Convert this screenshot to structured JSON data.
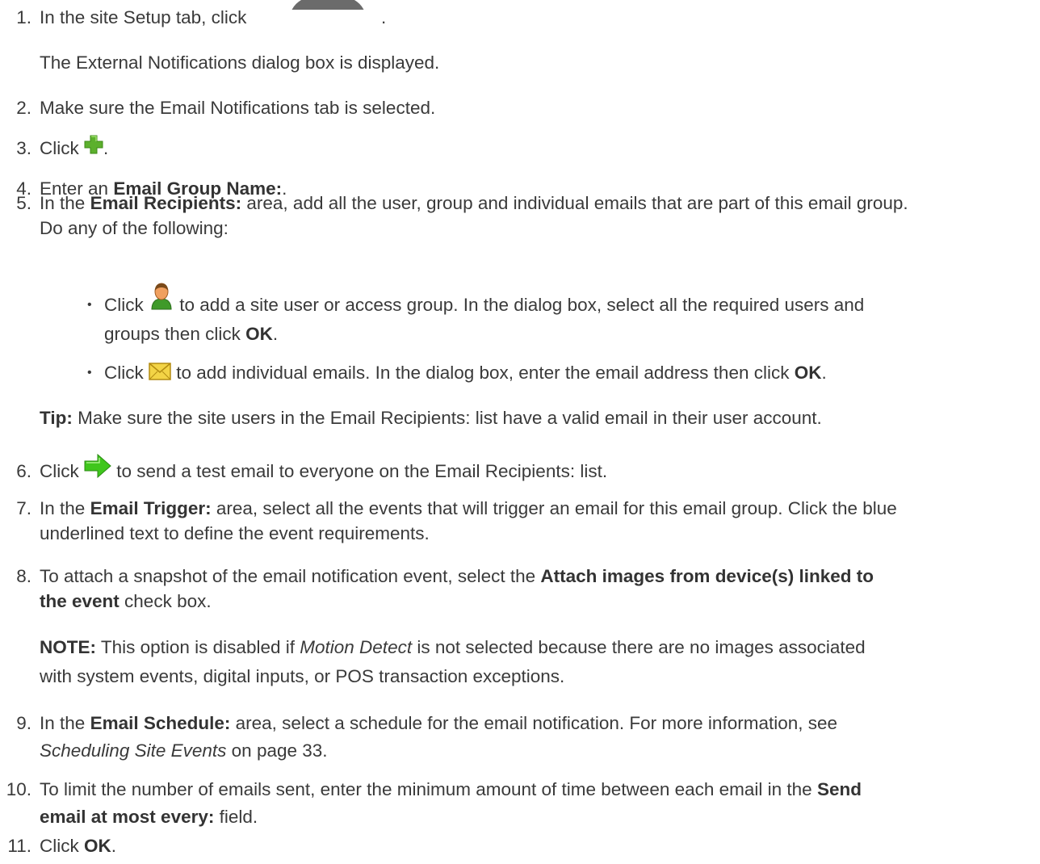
{
  "steps": {
    "s1": {
      "num": "1.",
      "pre": "In the site Setup tab, click",
      "post": "."
    },
    "s1_result": "The External Notifications dialog box is displayed.",
    "s2": {
      "num": "2.",
      "text": "Make sure the Email Notifications tab is selected."
    },
    "s3": {
      "num": "3.",
      "pre": "Click",
      "post": "."
    },
    "s4": {
      "num": "4.",
      "pre": "Enter an",
      "bold": "Email Group Name:",
      "post": "."
    },
    "s5": {
      "num": "5.",
      "pre": "In the",
      "bold": "Email Recipients:",
      "post": "area, add all the user, group and individual emails that are part of this email group.",
      "line2": "Do any of the following:"
    },
    "b1": {
      "pre": "Click",
      "post": "to add a site user or access group. In the dialog box, select all the required users and",
      "line2_pre": "groups then click",
      "line2_bold": "OK",
      "line2_post": "."
    },
    "b2": {
      "pre": "Click",
      "post": "to add individual emails. In the dialog box, enter the email address then click",
      "bold": "OK",
      "end": "."
    },
    "tip": {
      "bold": "Tip:",
      "text": "Make sure the site users in the Email Recipients: list have a valid email in their user account."
    },
    "s6": {
      "num": "6.",
      "pre": "Click",
      "post": "to send a test email to everyone on the Email Recipients: list."
    },
    "s7": {
      "num": "7.",
      "pre": "In the",
      "bold": "Email Trigger:",
      "post": "area, select all the events that will trigger an email for this email group. Click the blue",
      "line2": "underlined text to define the event requirements."
    },
    "s8": {
      "num": "8.",
      "pre": "To attach a snapshot of the email notification event, select the",
      "bold": "Attach images from device(s) linked to",
      "line2_bold": "the event",
      "line2_post": "check box."
    },
    "note": {
      "bold": "NOTE:",
      "pre": "This option is disabled if",
      "italic": "Motion Detect",
      "post": "is not selected because there are no images associated",
      "line2": "with system events, digital inputs, or POS transaction exceptions."
    },
    "s9": {
      "num": "9.",
      "pre": "In the",
      "bold": "Email Schedule:",
      "post": "area, select a schedule for the email notification. For more information, see",
      "line2_italic": "Scheduling Site Events",
      "line2_post": "on page 33."
    },
    "s10": {
      "num": "10.",
      "pre": "To limit the number of emails sent, enter the minimum amount of time between each email in the",
      "bold": "Send",
      "line2_bold": "email at most every:",
      "line2_post": "field."
    },
    "s11": {
      "num": "11.",
      "pre": "Click",
      "bold": "OK",
      "post": "."
    }
  },
  "icons": {
    "s1": "toolbar-button-icon",
    "s3": "add-plus-icon",
    "b1": "user-icon",
    "b2": "envelope-icon",
    "s6": "green-arrow-icon"
  },
  "colors": {
    "text": "#3a3a3a",
    "plus_green": "#5cb02d",
    "arrow_green": "#3fc61c",
    "envelope_yellow": "#f3d446"
  }
}
